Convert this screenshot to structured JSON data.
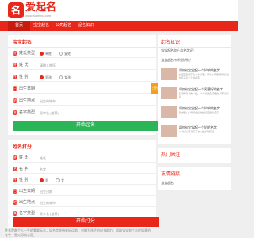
{
  "header": {
    "logo_char": "名",
    "site_name": "爱起名",
    "site_sub": "www.4qiming.com"
  },
  "nav": [
    "首页",
    "宝宝起名",
    "公司起名",
    "起名知识"
  ],
  "baby_form": {
    "title": "宝宝起名",
    "rows": [
      {
        "icon": "姓",
        "label": "姓氏类型",
        "options": [
          "单姓",
          "复姓"
        ],
        "selected": 0
      },
      {
        "icon": "姓",
        "label": "姓  氏",
        "value": "请输入姓氏"
      },
      {
        "icon": "性",
        "label": "性  别",
        "options": [
          "男孩",
          "女孩"
        ],
        "selected": 0
      },
      {
        "icon": "日",
        "label": "出生日期",
        "value": ""
      },
      {
        "icon": "地",
        "label": "出生地点",
        "value": "出生的城市"
      },
      {
        "icon": "名",
        "label": "名字类型",
        "value": "双字名 (推荐)"
      }
    ],
    "calendar_label": "日历",
    "submit": "开始起名"
  },
  "score_form": {
    "title": "姓名打分",
    "rows": [
      {
        "icon": "姓",
        "label": "姓  氏",
        "value": "姓氏"
      },
      {
        "icon": "名",
        "label": "名  字",
        "value": "名字"
      },
      {
        "icon": "性",
        "label": "性  别",
        "options": [
          "男",
          "女"
        ],
        "selected": 0
      },
      {
        "icon": "日",
        "label": "出生日期",
        "value": "出生日期"
      },
      {
        "icon": "地",
        "label": "出生地点",
        "value": "出生的城市"
      },
      {
        "icon": "类",
        "label": "名字类型",
        "value": "双字名 (推荐)"
      }
    ],
    "submit": "开始打分"
  },
  "footer_text": "姓名是每个人一生的重要标志，好名字能带来好运势，也能为孩子的成长助力，帮助宝宝取个吉祥如意的名字，是父母的心愿。",
  "sidebar": {
    "title": "起名知识",
    "items": [
      "宝宝起名取什么名字好？",
      "宝宝起名有哪些讲究？"
    ],
    "articles": [
      {
        "title": "如何给宝宝起一个好听的名字",
        "sub": "给宝宝起名字是一件大事，每个父母都希望自己的孩子有一个好名字"
      },
      {
        "title": "如何给宝宝起一个寓意好的名字",
        "sub": "名字伴随人的一生，一个好的名字能给人带来好运"
      },
      {
        "title": "如何给宝宝起一个好听的名字",
        "sub": "现在很多父母都会提前给宝宝想好名字"
      },
      {
        "title": "如何给宝宝起一个好的名字",
        "sub": "一个好名字对孩子的一生影响深远"
      }
    ],
    "section2_title": "热门关注",
    "section3_title": "友情链接",
    "link": "宝宝起名"
  },
  "colors": {
    "brand": "#e8271a",
    "green": "#2bb558",
    "orange": "#f0a020"
  }
}
